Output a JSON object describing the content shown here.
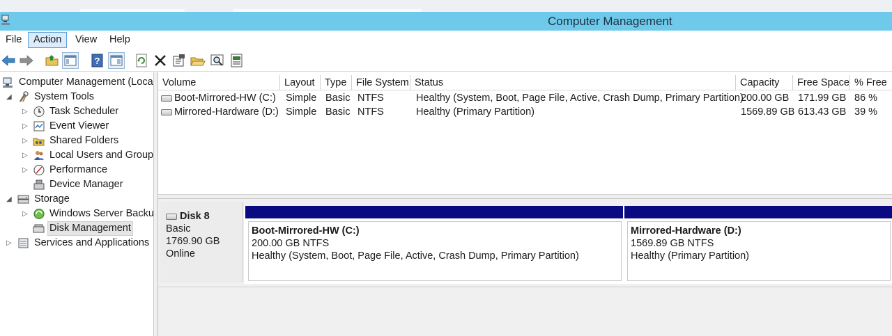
{
  "window": {
    "title": "Computer Management"
  },
  "menu": [
    {
      "label": "File"
    },
    {
      "label": "Action"
    },
    {
      "label": "View"
    },
    {
      "label": "Help"
    }
  ],
  "toolbar": {
    "buttons": [
      "back-arrow-icon",
      "forward-arrow-icon",
      "up-folder-icon",
      "show-hide-tree-icon",
      "help-icon",
      "show-hide-action-pane-icon",
      "refresh-icon",
      "delete-icon",
      "properties-icon",
      "open-icon",
      "search-icon",
      "export-icon"
    ]
  },
  "tree": {
    "items": [
      {
        "label": "Computer Management (Local"
      },
      {
        "label": "System Tools"
      },
      {
        "label": "Task Scheduler"
      },
      {
        "label": "Event Viewer"
      },
      {
        "label": "Shared Folders"
      },
      {
        "label": "Local Users and Groups"
      },
      {
        "label": "Performance"
      },
      {
        "label": "Device Manager"
      },
      {
        "label": "Storage"
      },
      {
        "label": "Windows Server Backup"
      },
      {
        "label": "Disk Management"
      },
      {
        "label": "Services and Applications"
      }
    ]
  },
  "volume_list": {
    "columns": [
      "Volume",
      "Layout",
      "Type",
      "File System",
      "Status",
      "Capacity",
      "Free Space",
      "% Free"
    ],
    "rows": [
      {
        "volume": "Boot-Mirrored-HW (C:)",
        "layout": "Simple",
        "type": "Basic",
        "fs": "NTFS",
        "status": "Healthy (System, Boot, Page File, Active, Crash Dump, Primary Partition)",
        "capacity": "200.00 GB",
        "free": "171.99 GB",
        "pct": "86 %"
      },
      {
        "volume": "Mirrored-Hardware (D:)",
        "layout": "Simple",
        "type": "Basic",
        "fs": "NTFS",
        "status": "Healthy (Primary Partition)",
        "capacity": "1569.89 GB",
        "free": "613.43 GB",
        "pct": "39 %"
      }
    ]
  },
  "disk": {
    "name": "Disk 8",
    "type": "Basic",
    "size": "1769.90 GB",
    "state": "Online",
    "partitions": [
      {
        "name": "Boot-Mirrored-HW  (C:)",
        "size_fs": "200.00 GB NTFS",
        "status": "Healthy (System, Boot, Page File, Active, Crash Dump, Primary Partition)"
      },
      {
        "name": "Mirrored-Hardware  (D:)",
        "size_fs": "1569.89 GB NTFS",
        "status": "Healthy (Primary Partition)"
      }
    ]
  },
  "colors": {
    "titlebar": "#6ec9ea",
    "partition_bar": "#0a0a82",
    "menu_active": "#dcecfc"
  }
}
